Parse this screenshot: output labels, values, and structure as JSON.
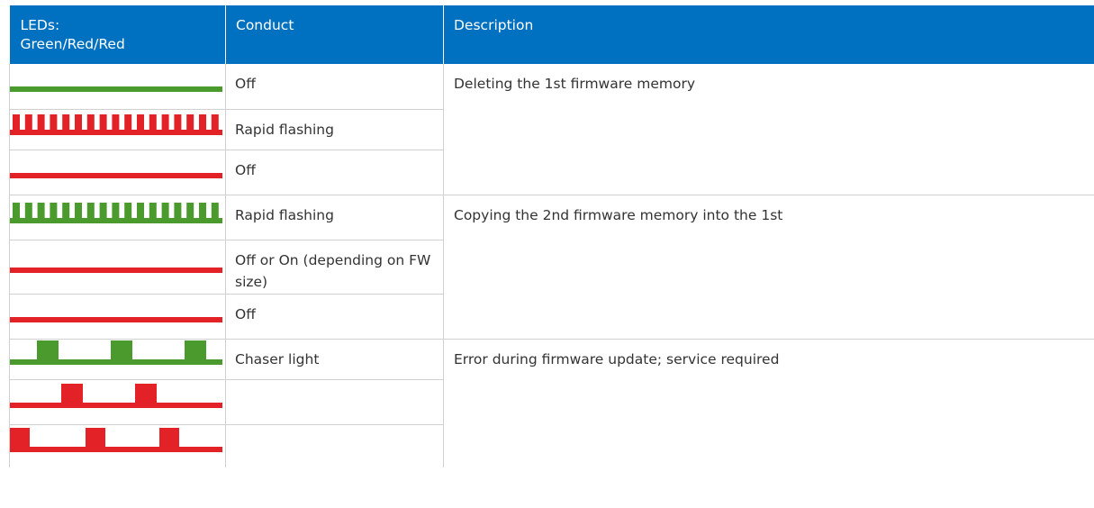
{
  "header": {
    "leds": "LEDs:\nGreen/Red/Red",
    "conduct": "Conduct",
    "description": "Description"
  },
  "colors": {
    "header_bg": "#0070c0",
    "green": "#4a9a2e",
    "red": "#e32228",
    "grid": "#d0d0d0"
  },
  "groups": [
    {
      "description": "Deleting the 1st firmware memory",
      "rows": [
        {
          "led_color": "green",
          "pattern": "line",
          "conduct": "Off"
        },
        {
          "led_color": "red",
          "pattern": "rapid",
          "conduct": "Rapid flashing"
        },
        {
          "led_color": "red",
          "pattern": "line",
          "conduct": "Off"
        }
      ]
    },
    {
      "description": "Copying the 2nd firmware memory into the 1st",
      "rows": [
        {
          "led_color": "green",
          "pattern": "rapid",
          "conduct": "Rapid flashing"
        },
        {
          "led_color": "red",
          "pattern": "line",
          "conduct": "Off or On (depending on FW size)"
        },
        {
          "led_color": "red",
          "pattern": "line",
          "conduct": "Off"
        }
      ]
    },
    {
      "description": "Error during firmware update; service required",
      "rows": [
        {
          "led_color": "green",
          "pattern": "chaser-1",
          "conduct": "Chaser light"
        },
        {
          "led_color": "red",
          "pattern": "chaser-2",
          "conduct": ""
        },
        {
          "led_color": "red",
          "pattern": "chaser-3",
          "conduct": ""
        }
      ]
    }
  ]
}
